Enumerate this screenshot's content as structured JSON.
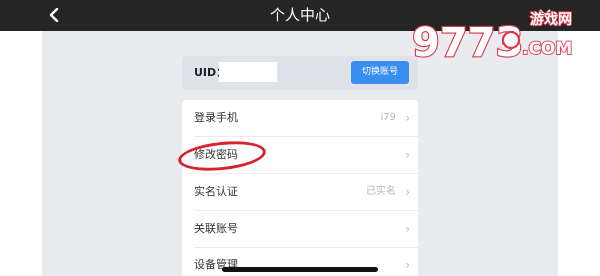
{
  "header": {
    "title": "个人中心",
    "back_icon": "back-arrow-icon",
    "bg_color": "#252525"
  },
  "uid_card": {
    "label": "UID：",
    "switch_label": "切换账号",
    "accent_color": "#3a8ef0"
  },
  "menu": {
    "items": [
      {
        "label": "登录手机",
        "value": "i79"
      },
      {
        "label": "修改密码",
        "value": ""
      },
      {
        "label": "实名认证",
        "value": "已实名"
      },
      {
        "label": "关联账号",
        "value": ""
      },
      {
        "label": "设备管理",
        "value": ""
      }
    ]
  },
  "annotation": {
    "color": "#d6232d"
  },
  "watermark": {
    "logo": "9773",
    "logo_tail": ".COM",
    "tag": "游戏网"
  }
}
